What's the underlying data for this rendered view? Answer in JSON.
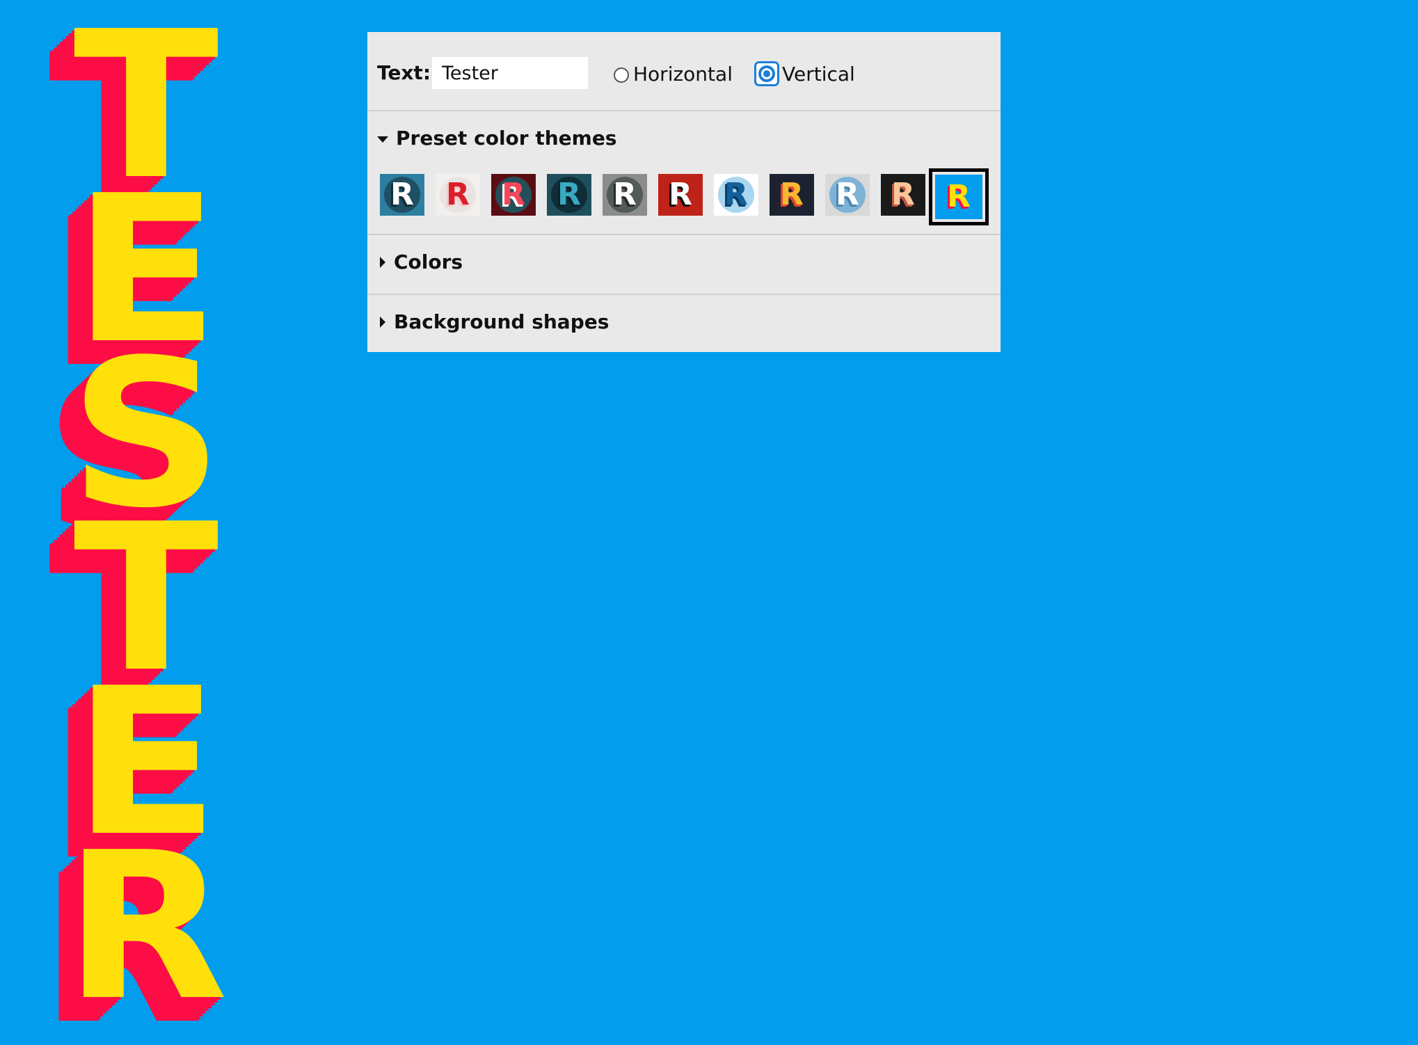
{
  "preview": {
    "letters": [
      "T",
      "E",
      "S",
      "T",
      "E",
      "R"
    ]
  },
  "controls": {
    "text_label": "Text:",
    "text_value": "Tester",
    "orientation": {
      "horizontal_label": "Horizontal",
      "vertical_label": "Vertical",
      "selected": "Vertical"
    }
  },
  "sections": {
    "preset_title": "Preset color themes",
    "preset_expanded": true,
    "colors_title": "Colors",
    "background_shapes_title": "Background shapes"
  },
  "themes": [
    {
      "glyph": "R",
      "bg": "#2c7fa0",
      "circle": "#1f4f63",
      "text": "#ffffff",
      "shadow": "#0f2e3b"
    },
    {
      "glyph": "R",
      "bg": "#f2f0ef",
      "circle": "#e9e4e2",
      "text": "#d9202b",
      "shadow": "#f5c9cc"
    },
    {
      "glyph": "R",
      "bg": "#5a0d12",
      "circle": "#244f5a",
      "text": "#f6475a",
      "shadow": "#ffffff"
    },
    {
      "glyph": "R",
      "bg": "#1f4e5c",
      "circle": "#0f2e38",
      "text": "#3aa9c2",
      "shadow": "#0b2129"
    },
    {
      "glyph": "R",
      "bg": "#8c8c8c",
      "circle": "#525b5a",
      "text": "#ffffff",
      "shadow": "#2b2b2b"
    },
    {
      "glyph": "R",
      "bg": "#bf2218",
      "circle": "#bf2218",
      "text": "#ffffff",
      "shadow": "#111111"
    },
    {
      "glyph": "R",
      "bg": "#ffffff",
      "circle": "#a9d6f0",
      "text": "#14609a",
      "shadow": "#0b3e66"
    },
    {
      "glyph": "R",
      "bg": "#1c2230",
      "circle": "#1c2230",
      "text": "#f7b733",
      "shadow": "#e0442a"
    },
    {
      "glyph": "R",
      "bg": "#d9d9d9",
      "circle": "#7fb3d6",
      "text": "#ffffff",
      "shadow": "#4b86b0"
    },
    {
      "glyph": "R",
      "bg": "#1a1a1a",
      "circle": "#1a1a1a",
      "text": "#fcc69b",
      "shadow": "#c0553e"
    },
    {
      "glyph": "R",
      "bg": "#029ded",
      "circle": "#029ded",
      "text": "#ffe00b",
      "shadow": "#fd0d45",
      "selected": true
    }
  ],
  "colors": {
    "page_background": "#029ded",
    "preview_text": "#ffe00b",
    "preview_shadow": "#fd0d45",
    "panel_background": "#e9e9e9",
    "accent": "#1c7fd8"
  }
}
